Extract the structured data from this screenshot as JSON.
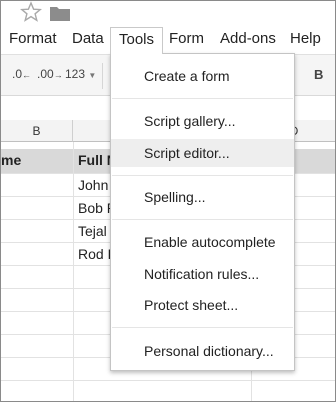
{
  "menubar": {
    "items": [
      {
        "label": "Format"
      },
      {
        "label": "Data"
      },
      {
        "label": "Tools"
      },
      {
        "label": "Form"
      },
      {
        "label": "Add-ons"
      },
      {
        "label": "Help"
      }
    ]
  },
  "toolbar": {
    "decrease_decimals_label": ".0",
    "increase_decimals_label": ".00",
    "format_label": "123",
    "bold_label": "B"
  },
  "grid": {
    "columns": [
      "B",
      "D"
    ],
    "header_row": [
      "me",
      "Full N"
    ],
    "names": [
      "John",
      "Bob P",
      "Tejal",
      "Rod K"
    ]
  },
  "tools_menu": {
    "items": [
      {
        "label": "Create a form"
      },
      {
        "label": "Script gallery..."
      },
      {
        "label": "Script editor..."
      },
      {
        "label": "Spelling..."
      },
      {
        "label": "Enable autocomplete"
      },
      {
        "label": "Notification rules..."
      },
      {
        "label": "Protect sheet..."
      },
      {
        "label": "Personal dictionary..."
      }
    ]
  }
}
